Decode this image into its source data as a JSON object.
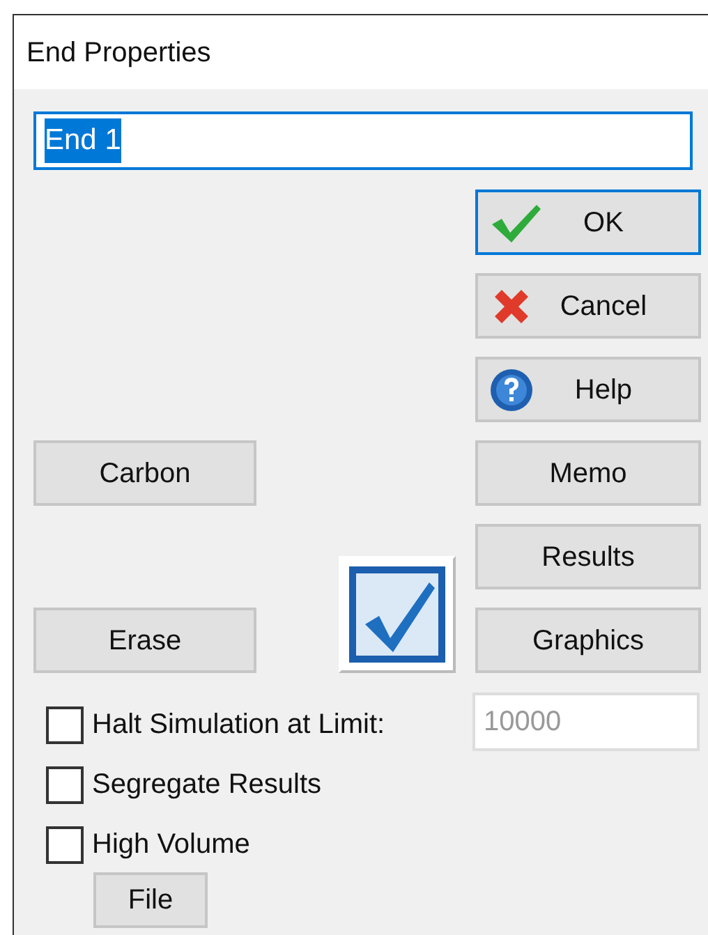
{
  "window": {
    "title": "End Properties"
  },
  "name_field": {
    "value": "End 1",
    "text_selected": true,
    "focused": true
  },
  "side_buttons": [
    {
      "label": "OK",
      "kind": "confirm",
      "default": true
    },
    {
      "label": "Cancel",
      "kind": "cancel",
      "default": false
    },
    {
      "label": "Help",
      "kind": "help",
      "default": false
    },
    {
      "label": "Memo",
      "kind": "plain",
      "default": false
    },
    {
      "label": "Results",
      "kind": "plain",
      "default": false
    },
    {
      "label": "Graphics",
      "kind": "plain",
      "default": false
    }
  ],
  "left_buttons": [
    {
      "label": "Carbon"
    },
    {
      "label": "Erase"
    }
  ],
  "options": [
    {
      "label": "Halt Simulation at Limit:",
      "checked": false
    },
    {
      "label": "Segregate Results",
      "checked": false
    },
    {
      "label": "High Volume",
      "checked": false
    }
  ],
  "limit_field": {
    "value": "10000",
    "disabled": true
  },
  "file_button": {
    "label": "File"
  }
}
